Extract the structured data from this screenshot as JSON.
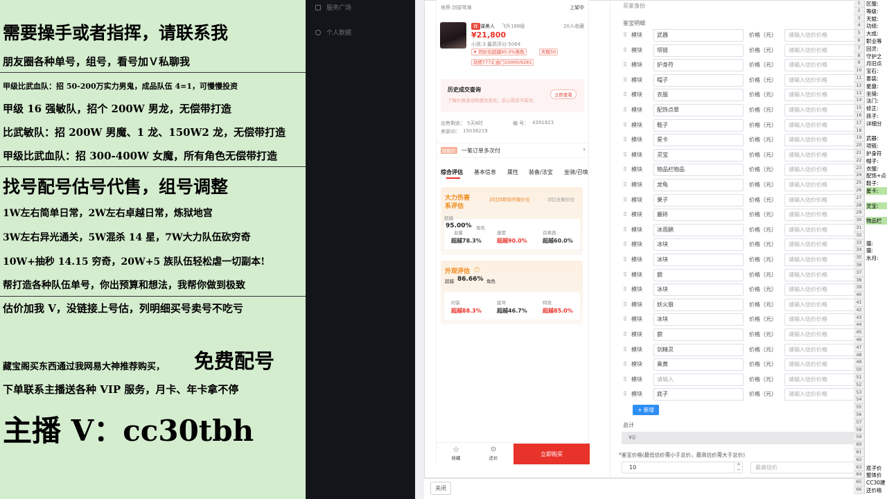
{
  "left_panel": {
    "lines": [
      "需要操手或者指挥，请联系我",
      "朋友圈各种单号，组号，看号加Ｖ私聊我",
      "甲级比武血队：招 50-200万实力男鬼，成品队伍 4=1，可慢慢投资",
      "甲级 16 强敏队，招个 200W 男龙，无偿带打造",
      "比武敏队：招 200W 男魔、1 龙、150W2 龙，无偿带打造",
      "甲级比武血队：招 300-400W 女魔，所有角色无偿带打造",
      "找号配号估号代售，组号调整",
      "1W左右简单日常，2W左右卓越日常，炼狱地宫",
      "3W左右异光通关，5W混杀 14 星，7W大力队伍砍穷奇",
      "10W+抽秒 14.15 穷奇，20W+5 族队伍轻松虐一切副本!",
      "帮打造各种队伍单号，你出预算和想法，我帮你做到极致",
      "估价加我 V，没链接上号估，列明细买号卖号不吃亏",
      "藏宝阁买东西通过我网易大神推荐购买，",
      "免费配号",
      "下单联系主播送各种 VIP 服务，月卡、年卡拿不停",
      "主播 V：cc30tbh"
    ]
  },
  "nav": {
    "items": [
      {
        "label": "服务广场",
        "icon": "grid-icon"
      },
      {
        "label": "个人数据",
        "icon": "user-icon"
      }
    ]
  },
  "phone": {
    "server_label": "服务器",
    "server": "地界:剑拔弩海",
    "status": "上架中",
    "seller_prefix": "祥",
    "seller_name": "谋美人",
    "level": "飞升188级",
    "favorites": "20人收藏",
    "price": "¥21,800",
    "sub_info": "小孩:3  最高评分:5064",
    "tag1": "✦ 同价位超越95.0%角色",
    "tag2": "天赋50",
    "tag3": "功绩7771",
    "tag4": "由门10000/9281",
    "history_title": "历史成交查询",
    "history_desc": "了解价格波动和属性变化，安心购买不踩坑",
    "history_btn": "立即查看",
    "publicity_label": "出售剩余：",
    "publicity_value": "5天8时",
    "id_label": "编  号：",
    "id_value": "4391823",
    "seller_id_label": "卖家ID：",
    "seller_id_value": "15038219",
    "promo_badge": "跨服价",
    "promo_text": "一笔订单多次付",
    "tabs": [
      "综合评估",
      "基本信息",
      "属性",
      "装备/法宝",
      "坐骑/召唤"
    ],
    "eval1": {
      "title": "大力伤害系评估",
      "badge": "对比同职段开服价位",
      "compare": "对比全服价位",
      "left_label": "超越",
      "left_value": "95.00%",
      "left_suffix": "角色",
      "items": [
        {
          "label": "血量",
          "value": "超越78.3%"
        },
        {
          "label": "速度",
          "value": "超越90.0%"
        },
        {
          "label": "召唤兽",
          "value": "超越60.0%"
        }
      ]
    },
    "eval2": {
      "title": "外观评估",
      "left_label": "超越",
      "left_value": "86.66%",
      "left_suffix": "角色",
      "items": [
        {
          "label": "时装",
          "value": "超越88.3%"
        },
        {
          "label": "座驾",
          "value": "超越46.7%"
        },
        {
          "label": "特效",
          "value": "超越85.0%"
        }
      ]
    },
    "fav_label": "收藏",
    "bargain_label": "还价",
    "buy_label": "立即购买"
  },
  "form": {
    "buyer_identity": "买家身份",
    "section_label": "鉴宝明细",
    "module_label": "模块",
    "price_label": "价格（元）",
    "price_placeholder": "请输入估价价格",
    "rows": [
      "武器",
      "项链",
      "护身符",
      "帽子",
      "衣服",
      "配饰点翠",
      "鞋子",
      "星卡",
      "灵宝",
      "物品栏物品",
      "龙龟",
      "果子",
      "搬砖",
      "冰雨鹂",
      "冰块",
      "冰块",
      "貌",
      "冰块",
      "妖火狼",
      "冰块",
      "貌",
      "剑精灵",
      "乘黄",
      "",
      "底子"
    ],
    "empty_placeholder": "请输入",
    "add_button": "+ 新增",
    "total_label": "总计",
    "total_value": "¥0",
    "appraise_label": "*鉴宝价格(最低估价需小于总价，最高估价需大于总价)",
    "min_value": "10",
    "max_placeholder": "最高估价",
    "close_button": "关闭"
  },
  "sheet": {
    "row_numbers": [
      "1",
      "2",
      "3",
      "4",
      "5",
      "6",
      "7",
      "8",
      "9",
      "10",
      "11",
      "12",
      "13",
      "14",
      "15",
      "16",
      "17",
      "18",
      "19",
      "20",
      "21",
      "22",
      "23",
      "24",
      "25",
      "26",
      "27",
      "28",
      "29",
      "30",
      "31",
      "32",
      "33",
      "34",
      "35",
      "36",
      "37",
      "38",
      "39",
      "40",
      "41",
      "42",
      "43",
      "44",
      "45",
      "46",
      "47",
      "48",
      "49",
      "50",
      "51",
      "52",
      "53",
      "54",
      "55",
      "56",
      "57",
      "58",
      "59",
      "60",
      "61",
      "62",
      "63",
      "64",
      "65",
      "66"
    ],
    "cells": [
      "区服:",
      "等级:",
      "天赋:",
      "功绩:",
      "大成:",
      "职业等",
      "回灵:",
      "守护之",
      "月旧点",
      "宝石:",
      "套装:",
      "星盘:",
      "坐骑:",
      "法门:",
      "修正:",
      "孩子:",
      "详细分",
      "",
      "武器:",
      "项链:",
      "护身符",
      "帽子:",
      "衣服:",
      "配饰+点",
      "鞋子:",
      "星卡:",
      "",
      "灵宝:",
      "",
      "物品栏",
      "",
      "",
      "猫:",
      "猫:",
      "水月:",
      "",
      "",
      "",
      "",
      "",
      "",
      "",
      "",
      "",
      "",
      "",
      "",
      "",
      "",
      "",
      "",
      "",
      "",
      "",
      "",
      "",
      "",
      "",
      "",
      "",
      "",
      "",
      "底子价",
      "整体价",
      "CC30建",
      "还价格"
    ],
    "highlight_color": "#b7e4a3"
  }
}
